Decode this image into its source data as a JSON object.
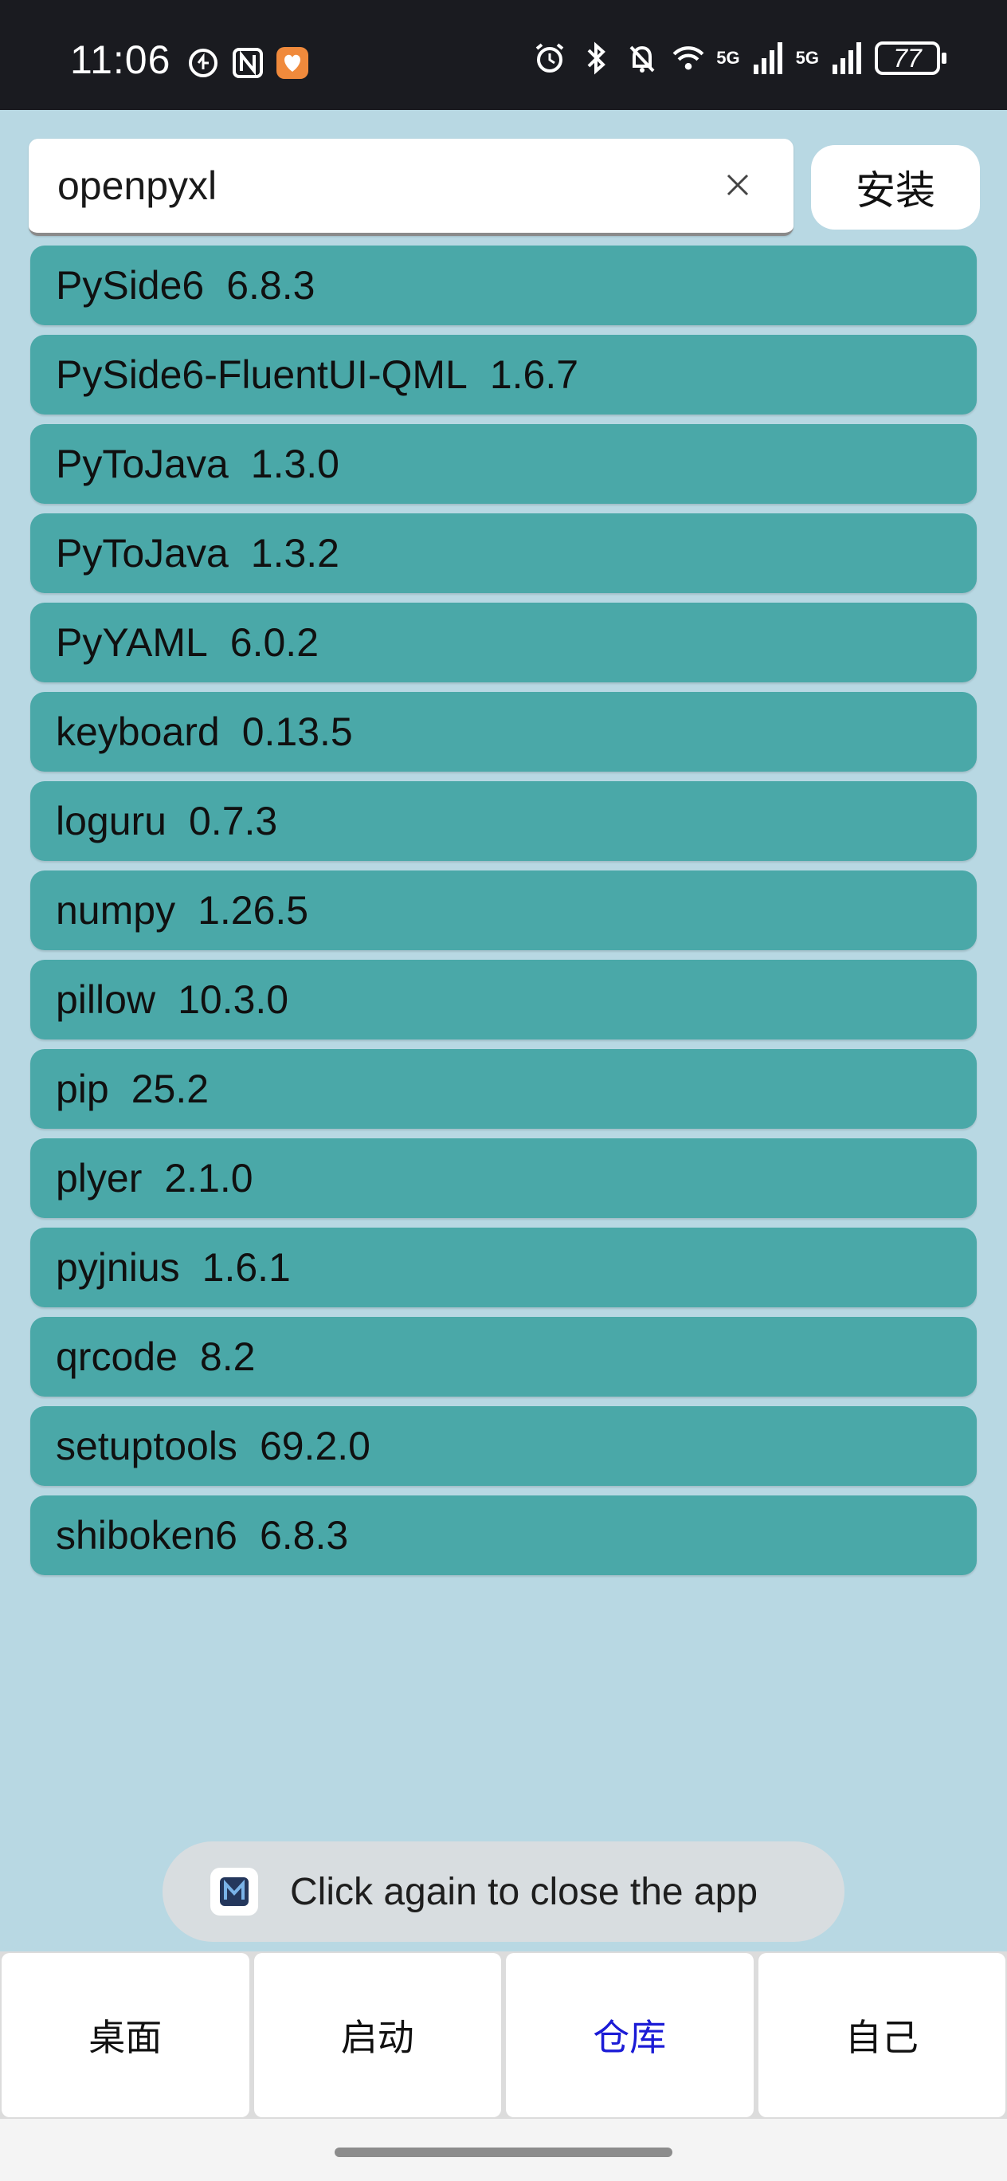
{
  "status_bar": {
    "time": "11:06",
    "battery": "77",
    "net_5g_a": "5G",
    "net_5g_b": "5G",
    "icons_left": [
      "data-saver-icon",
      "nfc-icon",
      "health-app-icon"
    ],
    "icons_right": [
      "alarm-icon",
      "bluetooth-icon",
      "mute-icon",
      "wifi-icon",
      "signal-icon",
      "signal-icon"
    ]
  },
  "search": {
    "value": "openpyxl",
    "clear_icon": "close-icon"
  },
  "install_label": "安装",
  "packages": [
    {
      "name": "PySide6",
      "version": "6.8.3"
    },
    {
      "name": "PySide6-FluentUI-QML",
      "version": "1.6.7"
    },
    {
      "name": "PyToJava",
      "version": "1.3.0"
    },
    {
      "name": "PyToJava",
      "version": "1.3.2"
    },
    {
      "name": "PyYAML",
      "version": "6.0.2"
    },
    {
      "name": "keyboard",
      "version": "0.13.5"
    },
    {
      "name": "loguru",
      "version": "0.7.3"
    },
    {
      "name": "numpy",
      "version": "1.26.5"
    },
    {
      "name": "pillow",
      "version": "10.3.0"
    },
    {
      "name": "pip",
      "version": "25.2"
    },
    {
      "name": "plyer",
      "version": "2.1.0"
    },
    {
      "name": "pyjnius",
      "version": "1.6.1"
    },
    {
      "name": "qrcode",
      "version": "8.2"
    },
    {
      "name": "setuptools",
      "version": "69.2.0"
    },
    {
      "name": "shiboken6",
      "version": "6.8.3"
    }
  ],
  "toast": {
    "text": "Click again to close the app",
    "icon": "app-logo-icon"
  },
  "tabs": [
    {
      "label": "桌面",
      "active": false
    },
    {
      "label": "启动",
      "active": false
    },
    {
      "label": "仓库",
      "active": true
    },
    {
      "label": "自己",
      "active": false
    }
  ],
  "colors": {
    "background": "#b8d8e3",
    "list_item": "#4aa8a8",
    "active_tab": "#1b1bd6",
    "status_bar": "#1a1b20"
  }
}
